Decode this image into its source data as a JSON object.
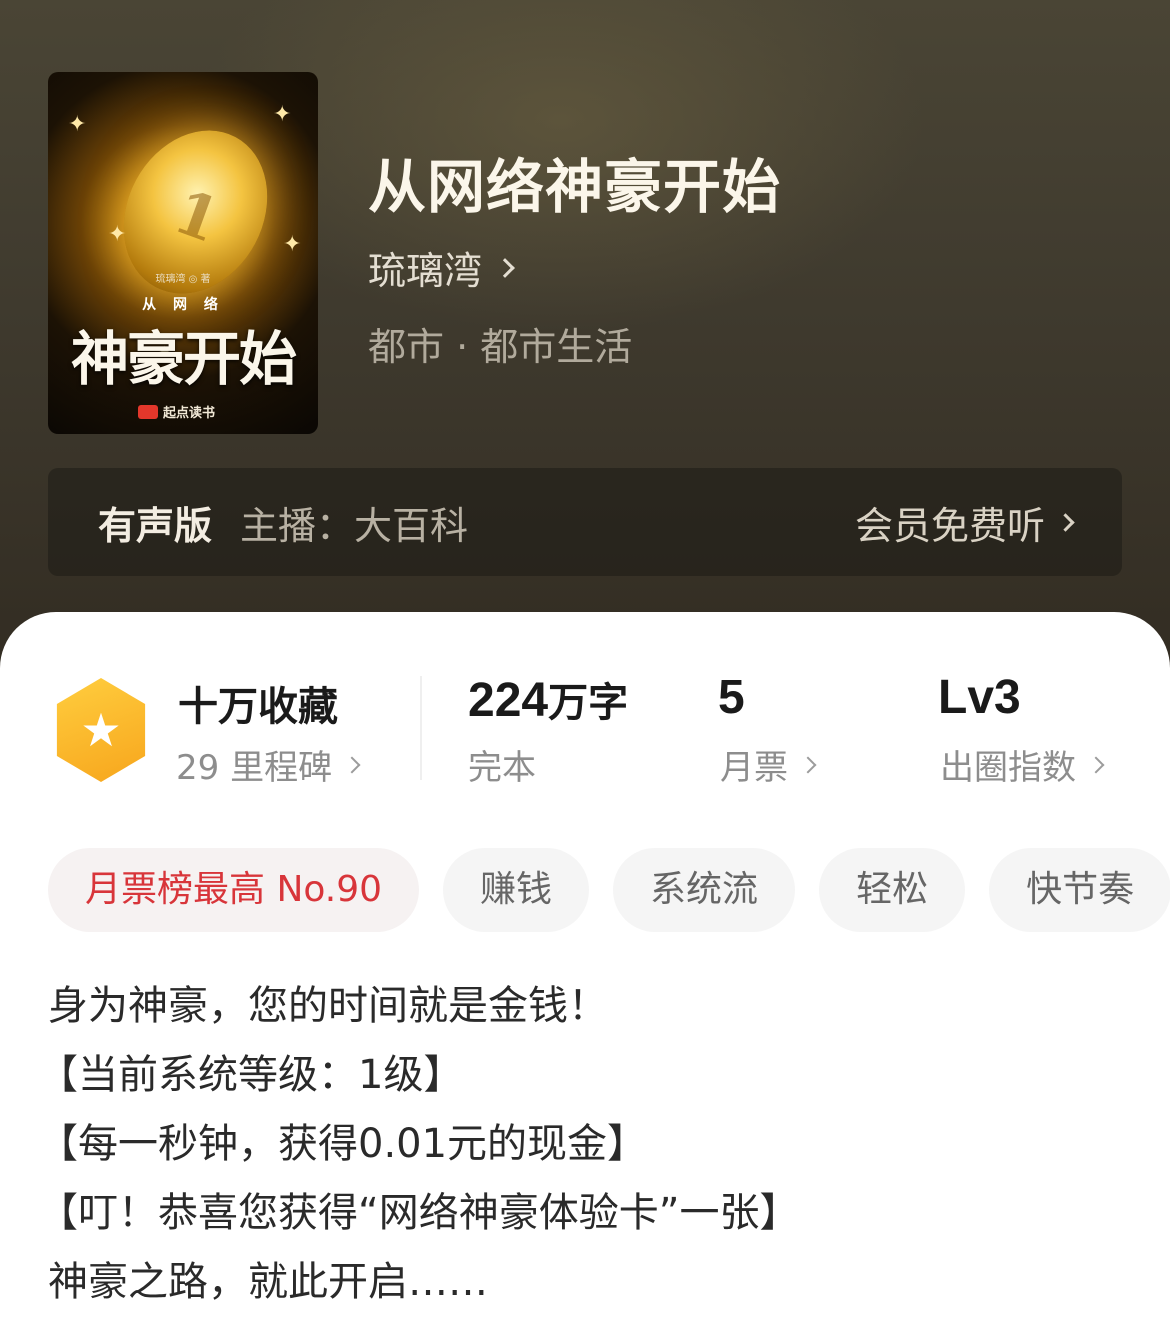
{
  "book": {
    "title": "从网络神豪开始",
    "author": "琉璃湾",
    "genre": "都市 · 都市生活",
    "cover": {
      "author_line": "琉璃湾 ◎ 著",
      "small_title": "从 网 络",
      "big_title": "神豪开始",
      "publisher": "起点读书",
      "coin_numeral": "1"
    }
  },
  "audio": {
    "label": "有声版",
    "host": "主播：大百科",
    "cta": "会员免费听"
  },
  "stats": {
    "collect": {
      "value": "十万收藏",
      "sub": "29 里程碑"
    },
    "words": {
      "number": "224",
      "unit": "万字",
      "sub": "完本"
    },
    "tickets": {
      "number": "5",
      "sub": "月票"
    },
    "influence": {
      "number": "Lv3",
      "sub": "出圈指数"
    }
  },
  "tags": [
    "月票榜最高 No.90",
    "赚钱",
    "系统流",
    "轻松",
    "快节奏"
  ],
  "blurb": [
    "身为神豪，您的时间就是金钱！",
    "【当前系统等级：1级】",
    "【每一秒钟，获得0.01元的现金】",
    "【叮！恭喜您获得“网络神豪体验卡”一张】",
    "神豪之路，就此开启……"
  ],
  "colors": {
    "hot_tag": "#d8353a",
    "badge_gradient_start": "#ffce3f",
    "badge_gradient_end": "#f7a51c"
  },
  "icons": [
    "star-badge-icon",
    "chevron-right-icon"
  ]
}
